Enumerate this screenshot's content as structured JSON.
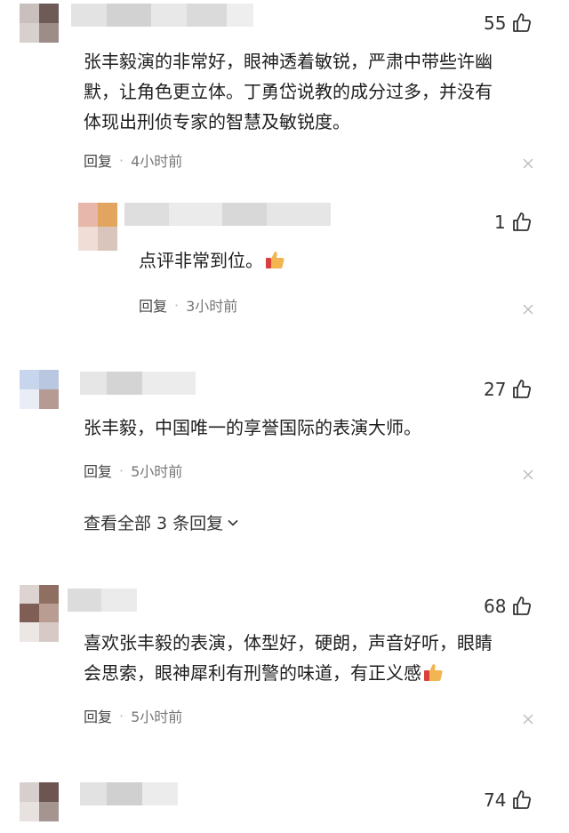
{
  "comments": [
    {
      "likes": "55",
      "lines": [
        "张丰毅演的非常好，眼神透着敏锐，严肃中带些许幽",
        "默，让角色更立体。丁勇岱说教的成分过多，并没有",
        "体现出刑侦专家的智慧及敏锐度。"
      ],
      "reply_label": "回复",
      "time": "4小时前"
    },
    {
      "likes": "1",
      "lines": [
        "点评非常到位。"
      ],
      "reply_label": "回复",
      "time": "3小时前"
    },
    {
      "likes": "27",
      "lines": [
        "张丰毅，中国唯一的享誉国际的表演大师。"
      ],
      "reply_label": "回复",
      "time": "5小时前",
      "more_replies": "查看全部 3 条回复"
    },
    {
      "likes": "68",
      "lines": [
        "喜欢张丰毅的表演，体型好，硬朗，声音好听，眼睛",
        "会思索，眼神犀利有刑警的味道，有正义感"
      ],
      "reply_label": "回复",
      "time": "5小时前"
    },
    {
      "likes": "74"
    }
  ],
  "icons": {
    "like": "thumbs-up-icon",
    "close": "close-icon",
    "emoji": "thumbs-up-emoji-icon",
    "chevron": "chevron-down-icon"
  },
  "colors": {
    "text": "#1f1f1f",
    "meta": "#777777"
  }
}
